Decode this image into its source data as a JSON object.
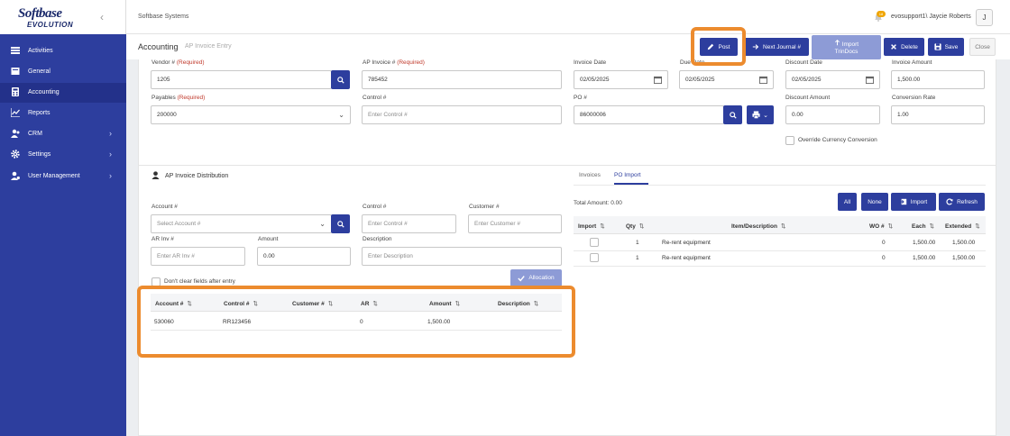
{
  "app": {
    "logo_line1": "Softbase",
    "logo_line2": "EVOLUTION",
    "company": "Softbase Systems",
    "user": "evosupport1\\ Jaycie Roberts",
    "avatar_initial": "J",
    "notification_count": "18"
  },
  "sidebar": {
    "items": [
      {
        "label": "Activities",
        "icon": "grid-icon"
      },
      {
        "label": "General",
        "icon": "folder-icon"
      },
      {
        "label": "Accounting",
        "icon": "calculator-icon",
        "active": true
      },
      {
        "label": "Reports",
        "icon": "chart-icon"
      },
      {
        "label": "CRM",
        "icon": "users-icon"
      },
      {
        "label": "Settings",
        "icon": "gear-icon"
      },
      {
        "label": "User Management",
        "icon": "user-gear-icon"
      }
    ]
  },
  "page": {
    "title": "Accounting",
    "subtitle": "AP Invoice Entry"
  },
  "toolbar": {
    "post": "Post",
    "next_journal": "Next Journal #",
    "import_trindocs_1": "Import",
    "import_trindocs_2": "TrinDocs",
    "delete": "Delete",
    "save": "Save",
    "close": "Close"
  },
  "header_form": {
    "vendor_label": "Vendor #",
    "required": "(Required)",
    "vendor_value": "1205",
    "ap_invoice_label": "AP Invoice #",
    "ap_invoice_value": "785452",
    "invoice_date_label": "Invoice Date",
    "invoice_date_value": "02/05/2025",
    "due_date_label": "Due Date",
    "due_date_value": "02/05/2025",
    "discount_date_label": "Discount Date",
    "discount_date_value": "02/05/2025",
    "invoice_amount_label": "Invoice Amount",
    "invoice_amount_value": "1,500.00",
    "payables_label": "Payables",
    "payables_value": "200000",
    "control_label": "Control #",
    "control_placeholder": "Enter Control #",
    "po_label": "PO #",
    "po_value": "86000006",
    "discount_amount_label": "Discount Amount",
    "discount_amount_value": "0.00",
    "conversion_rate_label": "Conversion Rate",
    "conversion_rate_value": "1.00",
    "override_label": "Override Currency Conversion"
  },
  "distribution": {
    "title": "AP Invoice Distribution",
    "account_label": "Account #",
    "account_placeholder": "Select Account #",
    "control_label": "Control #",
    "control_placeholder": "Enter Control #",
    "customer_label": "Customer #",
    "customer_placeholder": "Enter Customer #",
    "ar_inv_label": "AR Inv #",
    "ar_inv_placeholder": "Enter AR Inv #",
    "amount_label": "Amount",
    "amount_value": "0.00",
    "description_label": "Description",
    "description_placeholder": "Enter Description",
    "dont_clear_label": "Don't clear fields after entry",
    "allocation_button": "Allocation",
    "table": {
      "headers": [
        "Account #",
        "Control #",
        "Customer #",
        "AR",
        "Amount",
        "Description"
      ],
      "rows": [
        {
          "account": "530060",
          "control": "RR123456",
          "customer": "",
          "ar": "0",
          "amount": "1,500.00",
          "description": ""
        }
      ]
    }
  },
  "po_panel": {
    "tabs": [
      "Invoices",
      "PO Import"
    ],
    "active_tab": "PO Import",
    "total_amount_label": "Total Amount:",
    "total_amount_value": "0.00",
    "buttons": {
      "all": "All",
      "none": "None",
      "import": "Import",
      "refresh": "Refresh"
    },
    "table": {
      "headers": [
        "Import",
        "Qty",
        "Item/Description",
        "WO #",
        "Each",
        "Extended"
      ],
      "rows": [
        {
          "qty": "1",
          "item": "Re-rent equipment",
          "wo": "0",
          "each": "1,500.00",
          "extended": "1,500.00"
        },
        {
          "qty": "1",
          "item": "Re-rent equipment",
          "wo": "0",
          "each": "1,500.00",
          "extended": "1,500.00"
        }
      ]
    }
  },
  "colors": {
    "sidebar": "#2d3e9e",
    "accent": "#2d3e9e",
    "highlight": "#ec8b2e",
    "required": "#c0392b"
  }
}
